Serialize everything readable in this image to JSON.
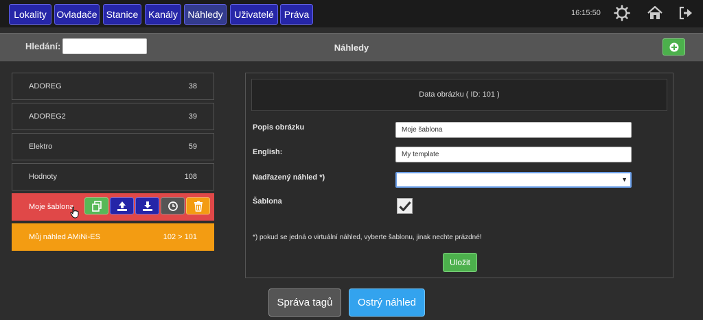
{
  "nav": {
    "items": [
      {
        "label": "Lokality"
      },
      {
        "label": "Ovladače"
      },
      {
        "label": "Stanice"
      },
      {
        "label": "Kanály"
      },
      {
        "label": "Náhledy"
      },
      {
        "label": "Uživatelé"
      },
      {
        "label": "Práva"
      }
    ],
    "active": "Náhledy",
    "time": "16:15:50",
    "icons": [
      "gear-icon",
      "home-icon",
      "logout-icon"
    ]
  },
  "search": {
    "label": "Hledání:",
    "value": ""
  },
  "page": {
    "title": "Náhledy"
  },
  "list": {
    "items": [
      {
        "label": "ADOREG",
        "count": "38"
      },
      {
        "label": "ADOREG2",
        "count": "39"
      },
      {
        "label": "Elektro",
        "count": "59"
      },
      {
        "label": "Hodnoty",
        "count": "108"
      },
      {
        "label": "Moje šablona",
        "count": "",
        "state": "selected"
      },
      {
        "label": "Můj náhled AMiNi-ES",
        "count": "102 > 101",
        "state": "highlighted"
      }
    ],
    "row_actions": [
      "copy-icon",
      "upload-icon",
      "download-icon",
      "history-icon",
      "trash-icon"
    ]
  },
  "detail": {
    "header": "Data obrázku ( ID: 101 )",
    "fields": {
      "popis_label": "Popis obrázku",
      "popis_value": "Moje šablona",
      "english_label": "English:",
      "english_value": "My template",
      "parent_label": "Nadřazený náhled *)",
      "parent_value": "",
      "template_label": "Šablona",
      "template_checked": true
    },
    "note": "*) pokud se jedná o virtuální náhled, vyberte šablonu, jinak nechte prázdné!",
    "save_label": "Uložit"
  },
  "footer": {
    "tags_label": "Správa tagů",
    "live_label": "Ostrý náhled"
  },
  "colors": {
    "nav_button": "#2626a8",
    "selected_row": "#e04848",
    "highlight_row": "#f39c12",
    "success": "#4cb04c",
    "primary": "#33a3ee"
  }
}
